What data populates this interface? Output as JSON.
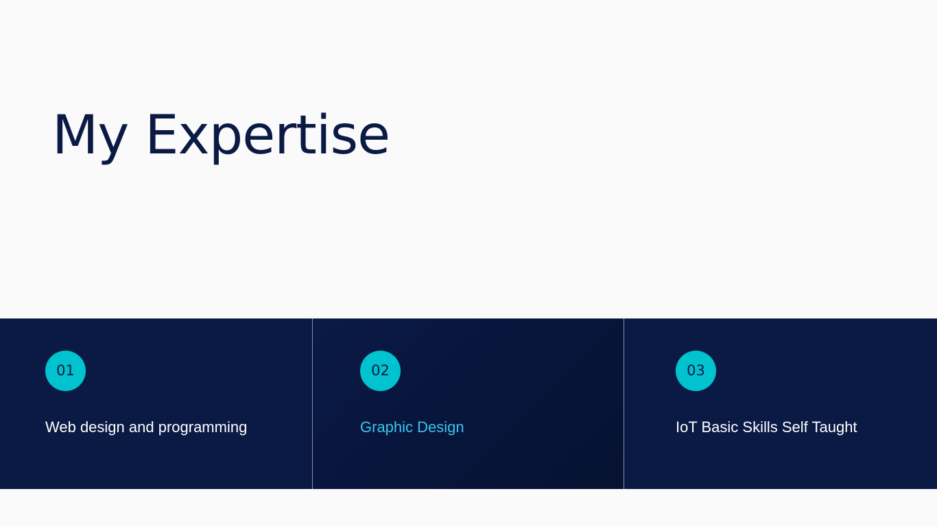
{
  "title": "My Expertise",
  "colors": {
    "background": "#fafafa",
    "title": "#0b1a45",
    "panel": "#0b1a45",
    "panel_highlight": "#061231",
    "badge": "#00c3cf",
    "label": "#ffffff",
    "label_highlight": "#37c7ee"
  },
  "items": [
    {
      "number": "01",
      "label": "Web design and programming"
    },
    {
      "number": "02",
      "label": "Graphic Design"
    },
    {
      "number": "03",
      "label": "IoT Basic Skills Self Taught"
    }
  ]
}
